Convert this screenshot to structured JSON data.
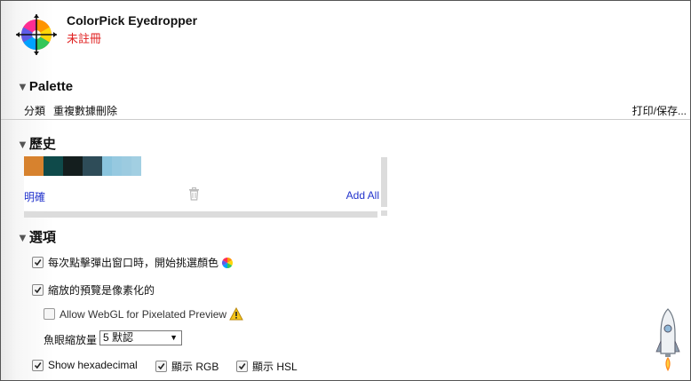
{
  "app": {
    "title": "ColorPick Eyedropper",
    "status": "未註冊"
  },
  "palette": {
    "heading": "Palette",
    "actions": {
      "categories": "分類",
      "dedupe": "重複數據刪除",
      "print_save": "打印/保存..."
    }
  },
  "history": {
    "heading": "歷史",
    "swatches": [
      "#d7822e",
      "#0f4a4a",
      "#141e1e",
      "#2e4c58",
      "#8ac4dd",
      "#96c9e0",
      "#9ccbe0",
      "#a2cfe2"
    ],
    "clear_label": "明確",
    "add_all_label": "Add All"
  },
  "options": {
    "heading": "選項",
    "open_on_click": {
      "label": "每次點擊彈出窗口時，開始挑選顏色",
      "checked": true
    },
    "pixelated_zoom": {
      "label": "縮放的預覽是像素化的",
      "checked": true
    },
    "webgl": {
      "label": "Allow WebGL for Pixelated Preview",
      "checked": false
    },
    "fisheye": {
      "label": "魚眼縮放量",
      "value": "5 默認"
    },
    "show_hex": {
      "label": "Show hexadecimal",
      "checked": true
    },
    "show_rgb": {
      "label": "顯示 RGB",
      "checked": true
    },
    "show_hsl": {
      "label": "顯示 HSL",
      "checked": true
    }
  }
}
